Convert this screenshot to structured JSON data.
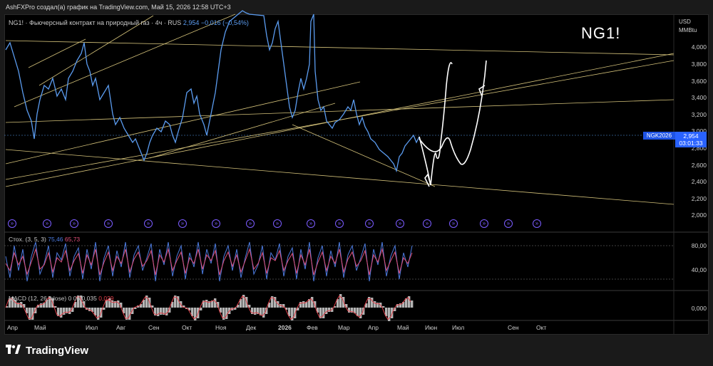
{
  "topbar": {
    "title": "AshFXPro создал(а) график на TradingView.com, Май 15, 2026 12:58 UTC+3"
  },
  "legend": {
    "symbol_text": "NG1! · Фьючерсный контракт на природный газ · 4ч · RUS",
    "price": "2,954",
    "change": "−0,016 (−0,54%)"
  },
  "title": "NG1!",
  "price_axis": {
    "currency": "USD",
    "unit": "MMBtu",
    "ticks": [
      "4,000",
      "3,800",
      "3,600",
      "3,400",
      "3,200",
      "3,000",
      "2,800",
      "2,600",
      "2,400",
      "2,200",
      "2,000"
    ]
  },
  "price_tag": {
    "ticker": "NGK2026",
    "price": "2,954",
    "countdown": "03:01:33"
  },
  "stoch": {
    "label": "Стох. (3, 5, 3)",
    "k": "75,46",
    "d": "65,73",
    "ticks": [
      "80,00",
      "40,00"
    ]
  },
  "macd": {
    "label": "MACD (12, 26, close)",
    "v1": "0",
    "v2": "06",
    "v3": "0,035",
    "v4": "0,029",
    "tick": "0,000"
  },
  "x_axis": {
    "ticks": [
      "Апр",
      "Май",
      "Июл",
      "Авг",
      "Сен",
      "Окт",
      "Ноя",
      "Дек",
      "2026",
      "Фев",
      "Мар",
      "Апр",
      "Май",
      "Июн",
      "Июл",
      "Сен",
      "Окт"
    ]
  },
  "footer": {
    "brand": "TradingView"
  },
  "colors": {
    "price_line": "#5b9cf0",
    "stoch_k": "#4c7be0",
    "stoch_d": "#e0507a",
    "trend": "#d4c27a",
    "price_tag": "#2962ff"
  },
  "chart_data": {
    "type": "line",
    "title": "NG1!",
    "ylim": [
      2.0,
      4.0
    ],
    "series": [
      {
        "values": [
          3.95,
          3.7,
          3.2,
          3.75,
          3.4,
          3.8,
          3.5,
          3.05,
          3.1,
          3.3,
          2.95,
          2.85,
          2.7,
          2.9,
          3.0,
          3.1,
          2.95,
          3.2,
          3.5,
          3.45,
          3.2,
          3.4,
          3.75,
          4.05,
          4.3,
          4.6,
          4.3,
          3.9,
          3.6,
          3.3,
          3.1,
          3.5,
          3.2,
          3.05,
          3.25,
          3.3,
          3.0,
          2.8,
          2.95,
          2.6,
          2.55,
          2.75,
          2.9,
          2.95
        ]
      }
    ]
  }
}
